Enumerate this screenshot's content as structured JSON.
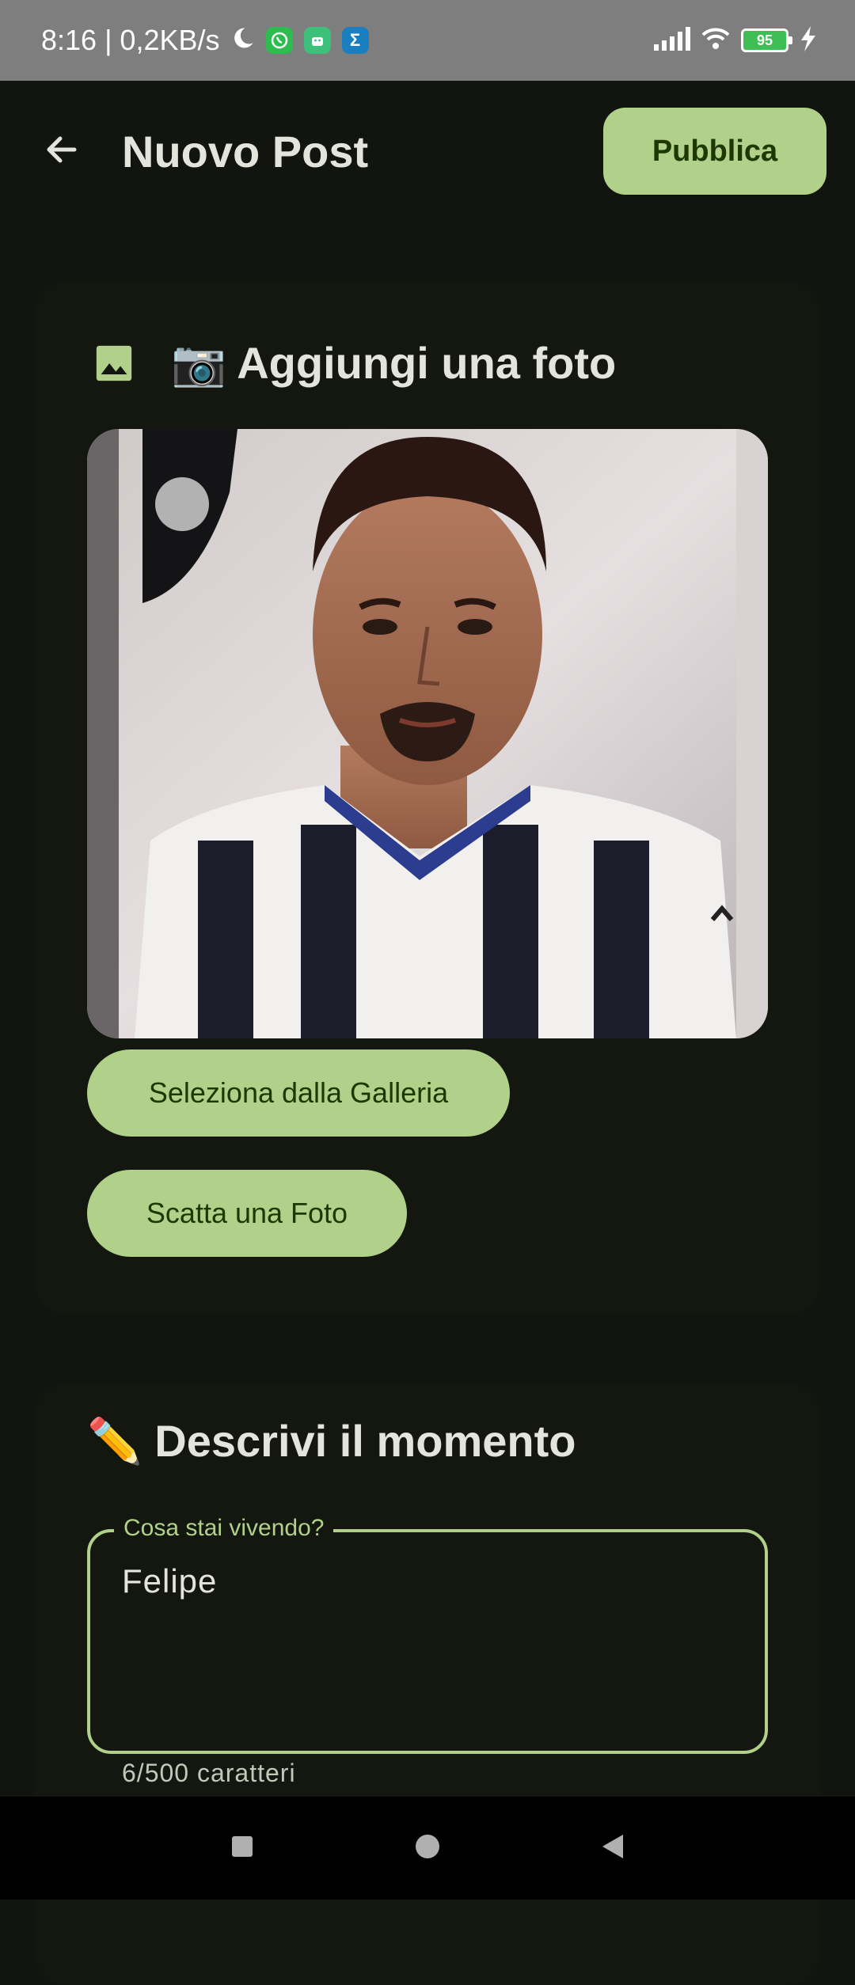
{
  "status_bar": {
    "time_and_speed": "8:16 | 0,2KB/s",
    "battery_level": "95",
    "icons": [
      "moon-icon",
      "whatsapp-icon",
      "android-app-icon",
      "sigma-app-icon",
      "signal-icon",
      "wifi-icon",
      "battery-icon",
      "charging-icon"
    ]
  },
  "top_bar": {
    "title": "Nuovo Post",
    "publish_label": "Pubblica",
    "back_icon": "arrow-back-icon"
  },
  "photo_section": {
    "icon": "image-icon",
    "title": "📷 Aggiungi una foto",
    "gallery_button": "Seleziona dalla Galleria",
    "camera_button": "Scatta una Foto"
  },
  "description_section": {
    "title": "✏️ Descrivi il momento",
    "field_label": "Cosa stai vivendo?",
    "field_value": "Felipe",
    "char_counter": "6/500 caratteri"
  },
  "colors": {
    "background": "#11140f",
    "card": "#14170f",
    "accent": "#b1d18a",
    "on_accent": "#1f3701",
    "text": "#e3e5dc"
  },
  "nav_bar": {
    "items": [
      "recents-square-icon",
      "home-circle-icon",
      "back-triangle-icon"
    ]
  }
}
